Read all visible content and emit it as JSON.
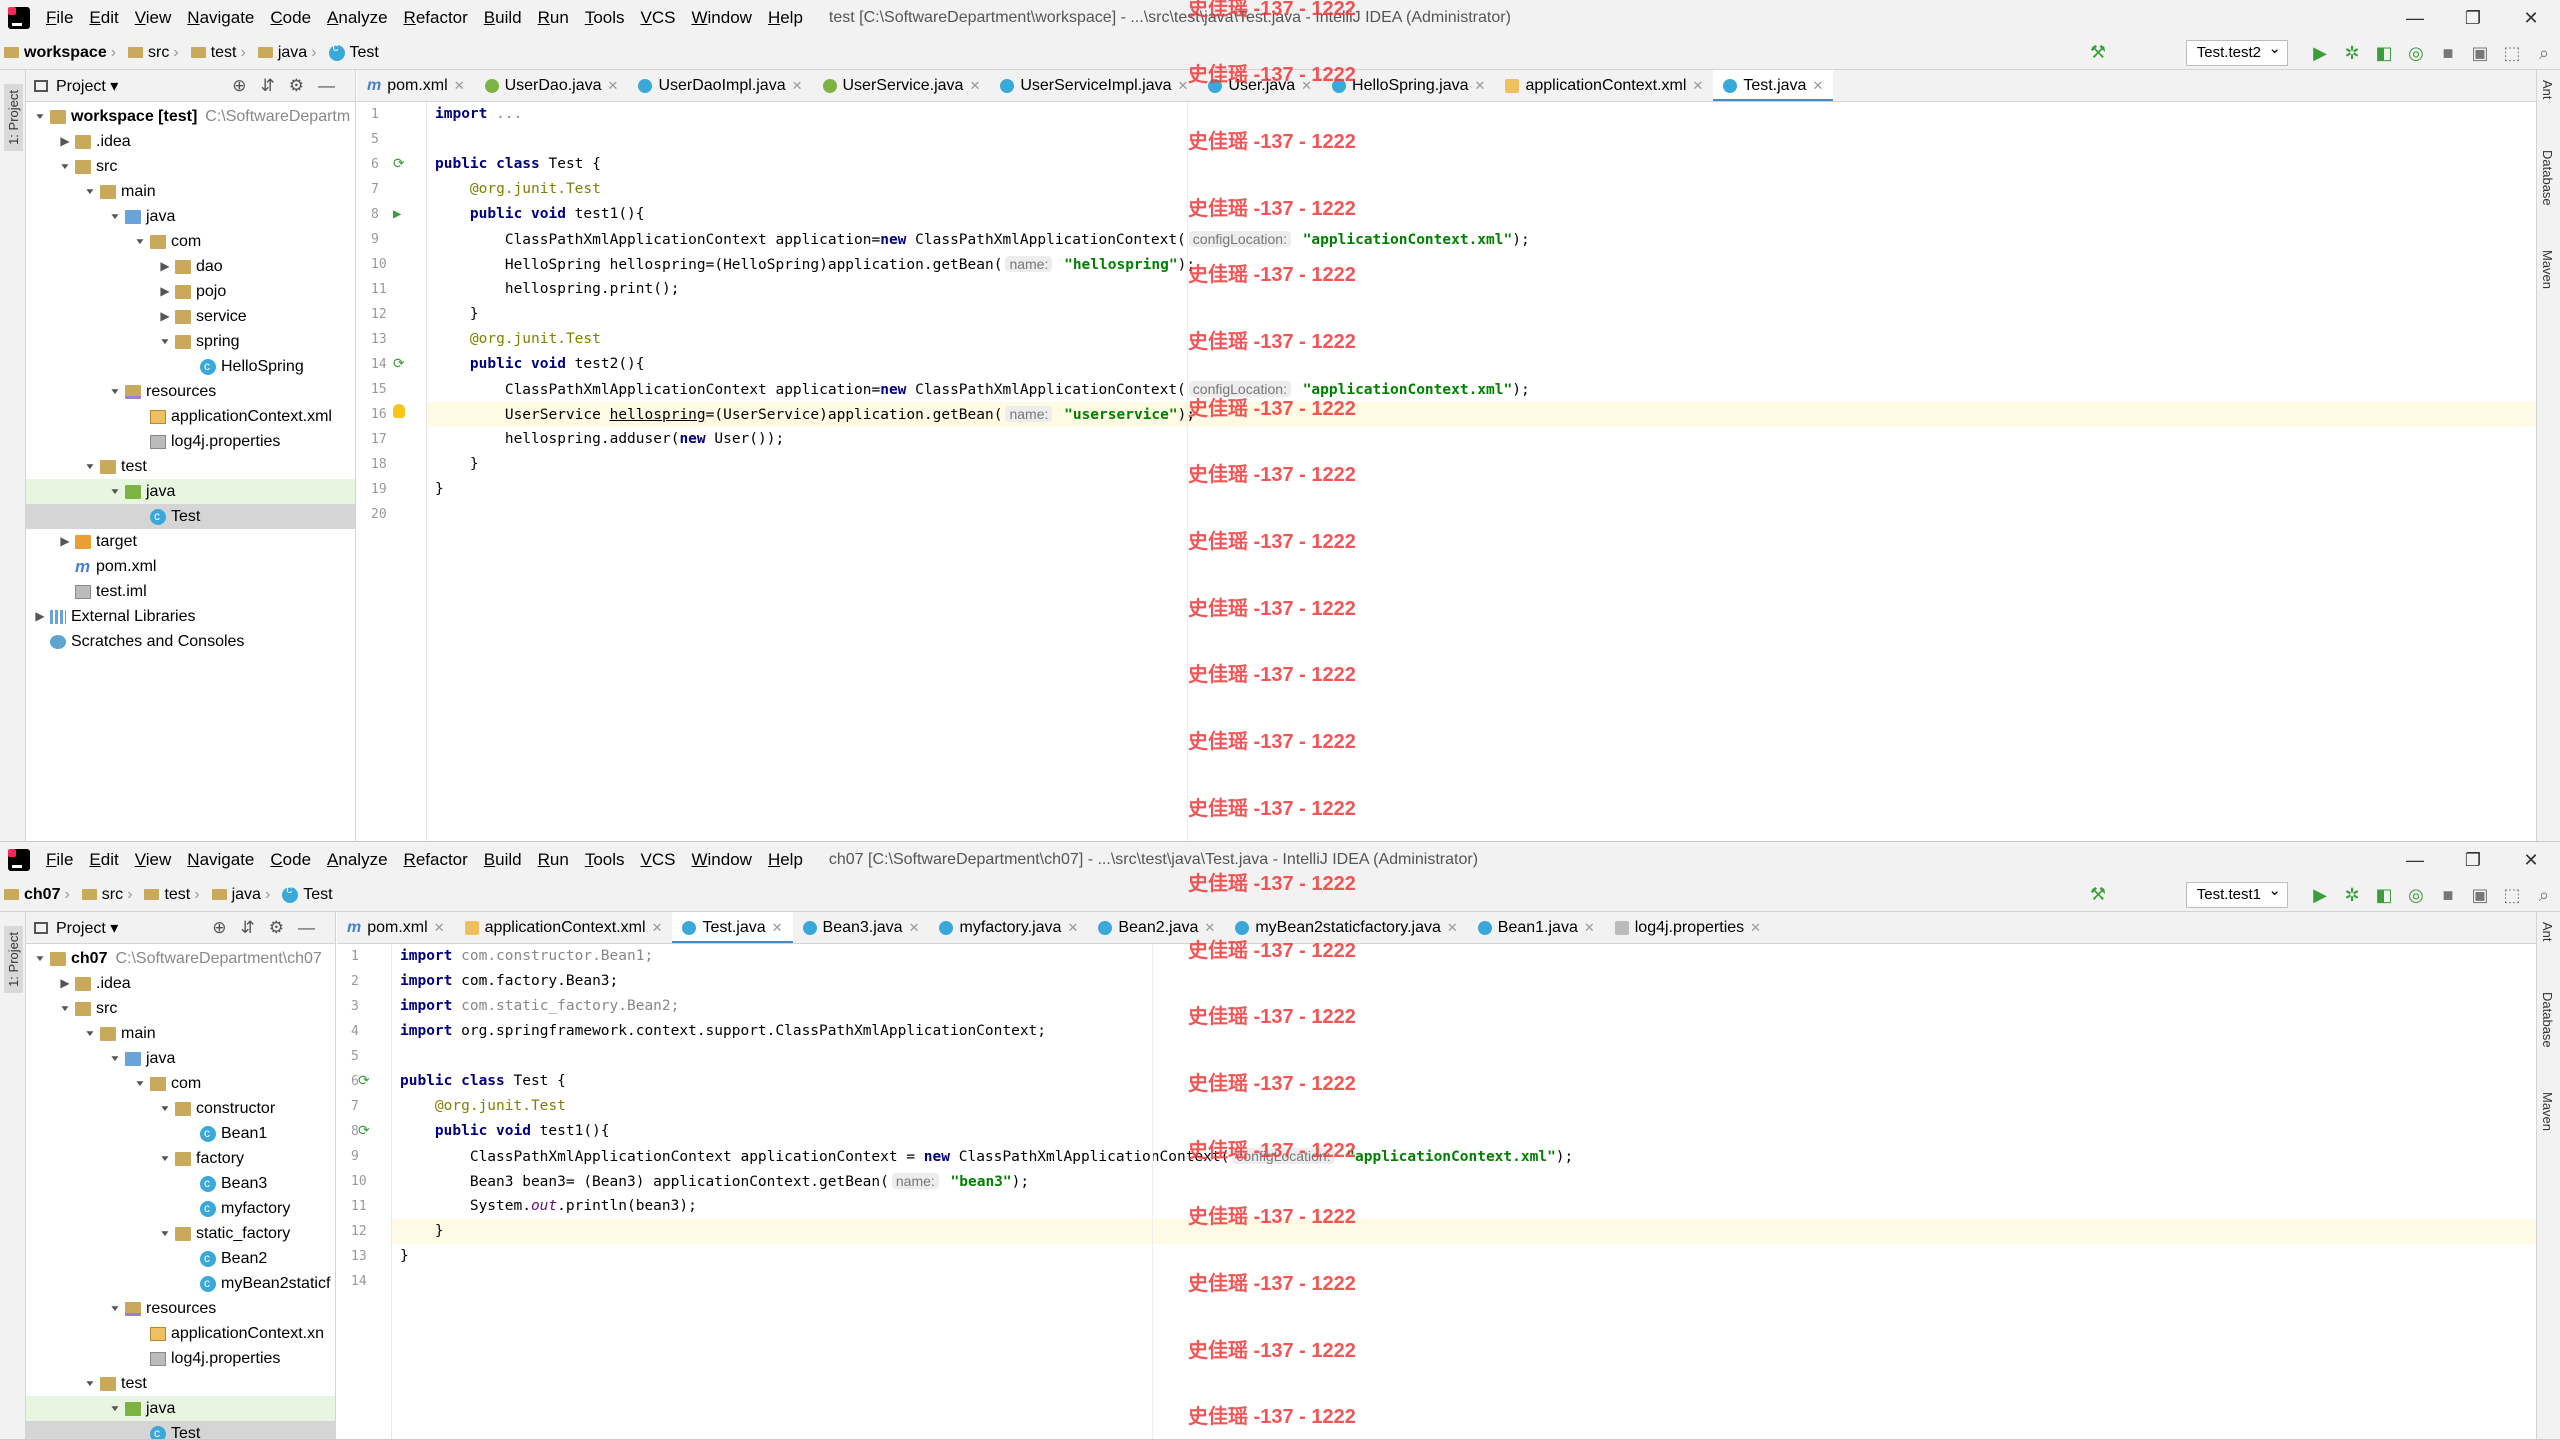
{
  "watermark": "史佳瑶 -137 - 1222",
  "ideA": {
    "menu": [
      "File",
      "Edit",
      "View",
      "Navigate",
      "Code",
      "Analyze",
      "Refactor",
      "Build",
      "Run",
      "Tools",
      "VCS",
      "Window",
      "Help"
    ],
    "title": "test [C:\\SoftwareDepartment\\workspace] - ...\\src\\test\\java\\Test.java - IntelliJ IDEA (Administrator)",
    "crumbs": [
      "workspace",
      "src",
      "test",
      "java",
      "Test"
    ],
    "run_config": "Test.test2",
    "panel_title": "Project",
    "tree": [
      {
        "t": "workspace [test]",
        "s": "C:\\SoftwareDepartm",
        "d": 0,
        "a": "v",
        "i": "fold",
        "b": true
      },
      {
        "t": ".idea",
        "d": 1,
        "a": ">",
        "i": "fold"
      },
      {
        "t": "src",
        "d": 1,
        "a": "v",
        "i": "fold"
      },
      {
        "t": "main",
        "d": 2,
        "a": "v",
        "i": "fold"
      },
      {
        "t": "java",
        "d": 3,
        "a": "v",
        "i": "blue"
      },
      {
        "t": "com",
        "d": 4,
        "a": "v",
        "i": "fold"
      },
      {
        "t": "dao",
        "d": 5,
        "a": ">",
        "i": "fold"
      },
      {
        "t": "pojo",
        "d": 5,
        "a": ">",
        "i": "fold"
      },
      {
        "t": "service",
        "d": 5,
        "a": ">",
        "i": "fold"
      },
      {
        "t": "spring",
        "d": 5,
        "a": "v",
        "i": "fold"
      },
      {
        "t": "HelloSpring",
        "d": 6,
        "a": "",
        "i": "class"
      },
      {
        "t": "resources",
        "d": 3,
        "a": "v",
        "i": "res"
      },
      {
        "t": "applicationContext.xml",
        "d": 4,
        "a": "",
        "i": "xml"
      },
      {
        "t": "log4j.properties",
        "d": 4,
        "a": "",
        "i": "prop"
      },
      {
        "t": "test",
        "d": 2,
        "a": "v",
        "i": "fold"
      },
      {
        "t": "java",
        "d": 3,
        "a": "v",
        "i": "green",
        "h": "hl2"
      },
      {
        "t": "Test",
        "d": 4,
        "a": "",
        "i": "class",
        "h": "hl"
      },
      {
        "t": "target",
        "d": 1,
        "a": ">",
        "i": "orange"
      },
      {
        "t": "pom.xml",
        "d": 1,
        "a": "",
        "i": "m"
      },
      {
        "t": "test.iml",
        "d": 1,
        "a": "",
        "i": "prop"
      },
      {
        "t": "External Libraries",
        "d": 0,
        "a": ">",
        "i": "lib"
      },
      {
        "t": "Scratches and Consoles",
        "d": 0,
        "a": "",
        "i": "scr"
      }
    ],
    "tabs": [
      {
        "t": "pom.xml",
        "i": "m"
      },
      {
        "t": "UserDao.java",
        "i": "i"
      },
      {
        "t": "UserDaoImpl.java",
        "i": "c"
      },
      {
        "t": "UserService.java",
        "i": "i"
      },
      {
        "t": "UserServiceImpl.java",
        "i": "c"
      },
      {
        "t": "User.java",
        "i": "c"
      },
      {
        "t": "HelloSpring.java",
        "i": "c"
      },
      {
        "t": "applicationContext.xml",
        "i": "x"
      },
      {
        "t": "Test.java",
        "i": "c",
        "a": true
      }
    ],
    "lines": [
      {
        "n": "1",
        "g": "",
        "h": "<span class=\"kw\">import</span> <span class=\"dim\">...</span>"
      },
      {
        "n": "5",
        "g": "",
        "h": ""
      },
      {
        "n": "6",
        "g": "run",
        "h": "<span class=\"kw\">public class</span> Test {"
      },
      {
        "n": "7",
        "g": "",
        "h": "    <span class=\"an\">@org.junit.Test</span>"
      },
      {
        "n": "8",
        "g": "play",
        "h": "    <span class=\"kw\">public void</span> test1(){"
      },
      {
        "n": "9",
        "g": "",
        "h": "        ClassPathXmlApplicationContext application=<span class=\"kw\">new</span> ClassPathXmlApplicationContext(<span class=\"hint\">configLocation:</span> <span class=\"st\">\"applicationContext.xml\"</span>);"
      },
      {
        "n": "10",
        "g": "",
        "h": "        HelloSpring hellospring=(HelloSpring)application.getBean(<span class=\"hint\">name:</span> <span class=\"st\">\"hellospring\"</span>);"
      },
      {
        "n": "11",
        "g": "",
        "h": "        hellospring.print();"
      },
      {
        "n": "12",
        "g": "",
        "h": "    }"
      },
      {
        "n": "13",
        "g": "",
        "h": "    <span class=\"an\">@org.junit.Test</span>"
      },
      {
        "n": "14",
        "g": "run",
        "h": "    <span class=\"kw\">public void</span> test2(){"
      },
      {
        "n": "15",
        "g": "",
        "h": "        ClassPathXmlApplicationContext application=<span class=\"kw\">new</span> ClassPathXmlApplicationContext(<span class=\"hint\">configLocation:</span> <span class=\"st\">\"applicationContext.xml\"</span>);"
      },
      {
        "n": "16",
        "g": "bulb",
        "c": true,
        "h": "        UserService <u>hellospring</u>=(UserService)application.getBean(<span class=\"hint\">name:</span> <span class=\"st\">\"userservice\"</span>);"
      },
      {
        "n": "17",
        "g": "",
        "h": "        hellospring.adduser(<span class=\"kw\">new</span> User());"
      },
      {
        "n": "18",
        "g": "",
        "h": "    }"
      },
      {
        "n": "19",
        "g": "",
        "h": "}"
      },
      {
        "n": "20",
        "g": "",
        "h": ""
      }
    ]
  },
  "ideB": {
    "menu": [
      "File",
      "Edit",
      "View",
      "Navigate",
      "Code",
      "Analyze",
      "Refactor",
      "Build",
      "Run",
      "Tools",
      "VCS",
      "Window",
      "Help"
    ],
    "title": "ch07 [C:\\SoftwareDepartment\\ch07] - ...\\src\\test\\java\\Test.java - IntelliJ IDEA (Administrator)",
    "crumbs": [
      "ch07",
      "src",
      "test",
      "java",
      "Test"
    ],
    "run_config": "Test.test1",
    "panel_title": "Project",
    "tree": [
      {
        "t": "ch07",
        "s": "C:\\SoftwareDepartment\\ch07",
        "d": 0,
        "a": "v",
        "i": "fold",
        "b": true
      },
      {
        "t": ".idea",
        "d": 1,
        "a": ">",
        "i": "fold"
      },
      {
        "t": "src",
        "d": 1,
        "a": "v",
        "i": "fold"
      },
      {
        "t": "main",
        "d": 2,
        "a": "v",
        "i": "fold"
      },
      {
        "t": "java",
        "d": 3,
        "a": "v",
        "i": "blue"
      },
      {
        "t": "com",
        "d": 4,
        "a": "v",
        "i": "fold"
      },
      {
        "t": "constructor",
        "d": 5,
        "a": "v",
        "i": "fold"
      },
      {
        "t": "Bean1",
        "d": 6,
        "a": "",
        "i": "class"
      },
      {
        "t": "factory",
        "d": 5,
        "a": "v",
        "i": "fold"
      },
      {
        "t": "Bean3",
        "d": 6,
        "a": "",
        "i": "class"
      },
      {
        "t": "myfactory",
        "d": 6,
        "a": "",
        "i": "class"
      },
      {
        "t": "static_factory",
        "d": 5,
        "a": "v",
        "i": "fold"
      },
      {
        "t": "Bean2",
        "d": 6,
        "a": "",
        "i": "class"
      },
      {
        "t": "myBean2staticf",
        "d": 6,
        "a": "",
        "i": "class"
      },
      {
        "t": "resources",
        "d": 3,
        "a": "v",
        "i": "res"
      },
      {
        "t": "applicationContext.xn",
        "d": 4,
        "a": "",
        "i": "xml"
      },
      {
        "t": "log4j.properties",
        "d": 4,
        "a": "",
        "i": "prop"
      },
      {
        "t": "test",
        "d": 2,
        "a": "v",
        "i": "fold"
      },
      {
        "t": "java",
        "d": 3,
        "a": "v",
        "i": "green",
        "h": "hl2"
      },
      {
        "t": "Test",
        "d": 4,
        "a": "",
        "i": "class",
        "h": "hl"
      }
    ],
    "tabs": [
      {
        "t": "pom.xml",
        "i": "m"
      },
      {
        "t": "applicationContext.xml",
        "i": "x"
      },
      {
        "t": "Test.java",
        "i": "c",
        "a": true
      },
      {
        "t": "Bean3.java",
        "i": "c"
      },
      {
        "t": "myfactory.java",
        "i": "c"
      },
      {
        "t": "Bean2.java",
        "i": "c"
      },
      {
        "t": "myBean2staticfactory.java",
        "i": "c"
      },
      {
        "t": "Bean1.java",
        "i": "c"
      },
      {
        "t": "log4j.properties",
        "i": "p"
      }
    ],
    "lines": [
      {
        "n": "1",
        "g": "",
        "h": "<span class=\"kw\">import</span> <span class=\"dim\">com.constructor.Bean1;</span>"
      },
      {
        "n": "2",
        "g": "",
        "h": "<span class=\"kw\">import</span> com.factory.Bean3;"
      },
      {
        "n": "3",
        "g": "",
        "h": "<span class=\"kw\">import</span> <span class=\"dim\">com.static_factory.Bean2;</span>"
      },
      {
        "n": "4",
        "g": "",
        "h": "<span class=\"kw\">import</span> org.springframework.context.support.ClassPathXmlApplicationContext;"
      },
      {
        "n": "5",
        "g": "",
        "h": ""
      },
      {
        "n": "6",
        "g": "run",
        "h": "<span class=\"kw\">public class</span> Test {"
      },
      {
        "n": "7",
        "g": "",
        "h": "    <span class=\"an\">@org.junit.Test</span>"
      },
      {
        "n": "8",
        "g": "run",
        "h": "    <span class=\"kw\">public void</span> test1(){"
      },
      {
        "n": "9",
        "g": "",
        "h": "        ClassPathXmlApplicationContext applicationContext = <span class=\"kw\">new</span> ClassPathXmlApplicationContext(<span class=\"hint\">configLocation:</span> <span class=\"st\">\"applicationContext.xml\"</span>);"
      },
      {
        "n": "10",
        "g": "",
        "h": "        Bean3 bean3= (Bean3) applicationContext.getBean(<span class=\"hint\">name:</span> <span class=\"st\">\"bean3\"</span>);"
      },
      {
        "n": "11",
        "g": "",
        "h": "        System.<span class=\"it\">out</span>.println(bean3);"
      },
      {
        "n": "12",
        "g": "",
        "c": true,
        "h": "    }"
      },
      {
        "n": "13",
        "g": "",
        "h": "}"
      },
      {
        "n": "14",
        "g": "",
        "h": ""
      }
    ]
  }
}
